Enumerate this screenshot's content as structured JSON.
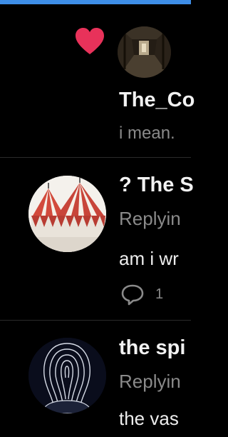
{
  "colors": {
    "accent": "#3e8ee8",
    "like": "#e8325a",
    "bg": "#000000"
  },
  "notification": {
    "icon": "heart-icon",
    "name": "The_Co",
    "snippet": "i mean."
  },
  "tweets": [
    {
      "name": "? The S",
      "replying": "Replyin",
      "text": "am i wr",
      "reply_icon": "reply-icon",
      "reply_count": "1"
    },
    {
      "name": "the spi",
      "replying": "Replyin",
      "text": "the vas"
    }
  ]
}
